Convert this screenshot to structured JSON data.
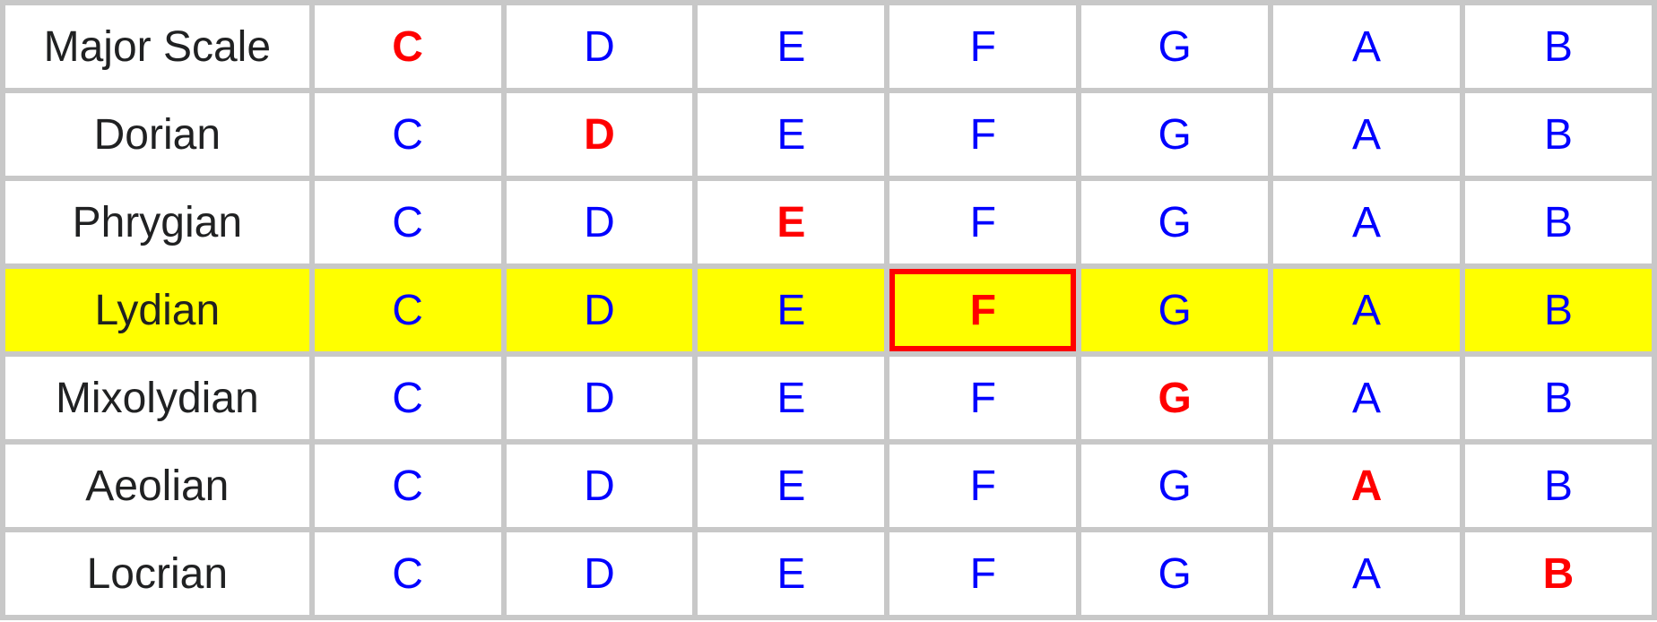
{
  "modes": {
    "highlighted_row_index": 3,
    "highlighted_cell": {
      "row": 3,
      "col": 4
    },
    "notes": [
      "C",
      "D",
      "E",
      "F",
      "G",
      "A",
      "B"
    ],
    "rows": [
      {
        "name": "Major Scale",
        "root_index": 0
      },
      {
        "name": "Dorian",
        "root_index": 1
      },
      {
        "name": "Phrygian",
        "root_index": 2
      },
      {
        "name": "Lydian",
        "root_index": 3
      },
      {
        "name": "Mixolydian",
        "root_index": 4
      },
      {
        "name": "Aeolian",
        "root_index": 5
      },
      {
        "name": "Locrian",
        "root_index": 6
      }
    ]
  }
}
